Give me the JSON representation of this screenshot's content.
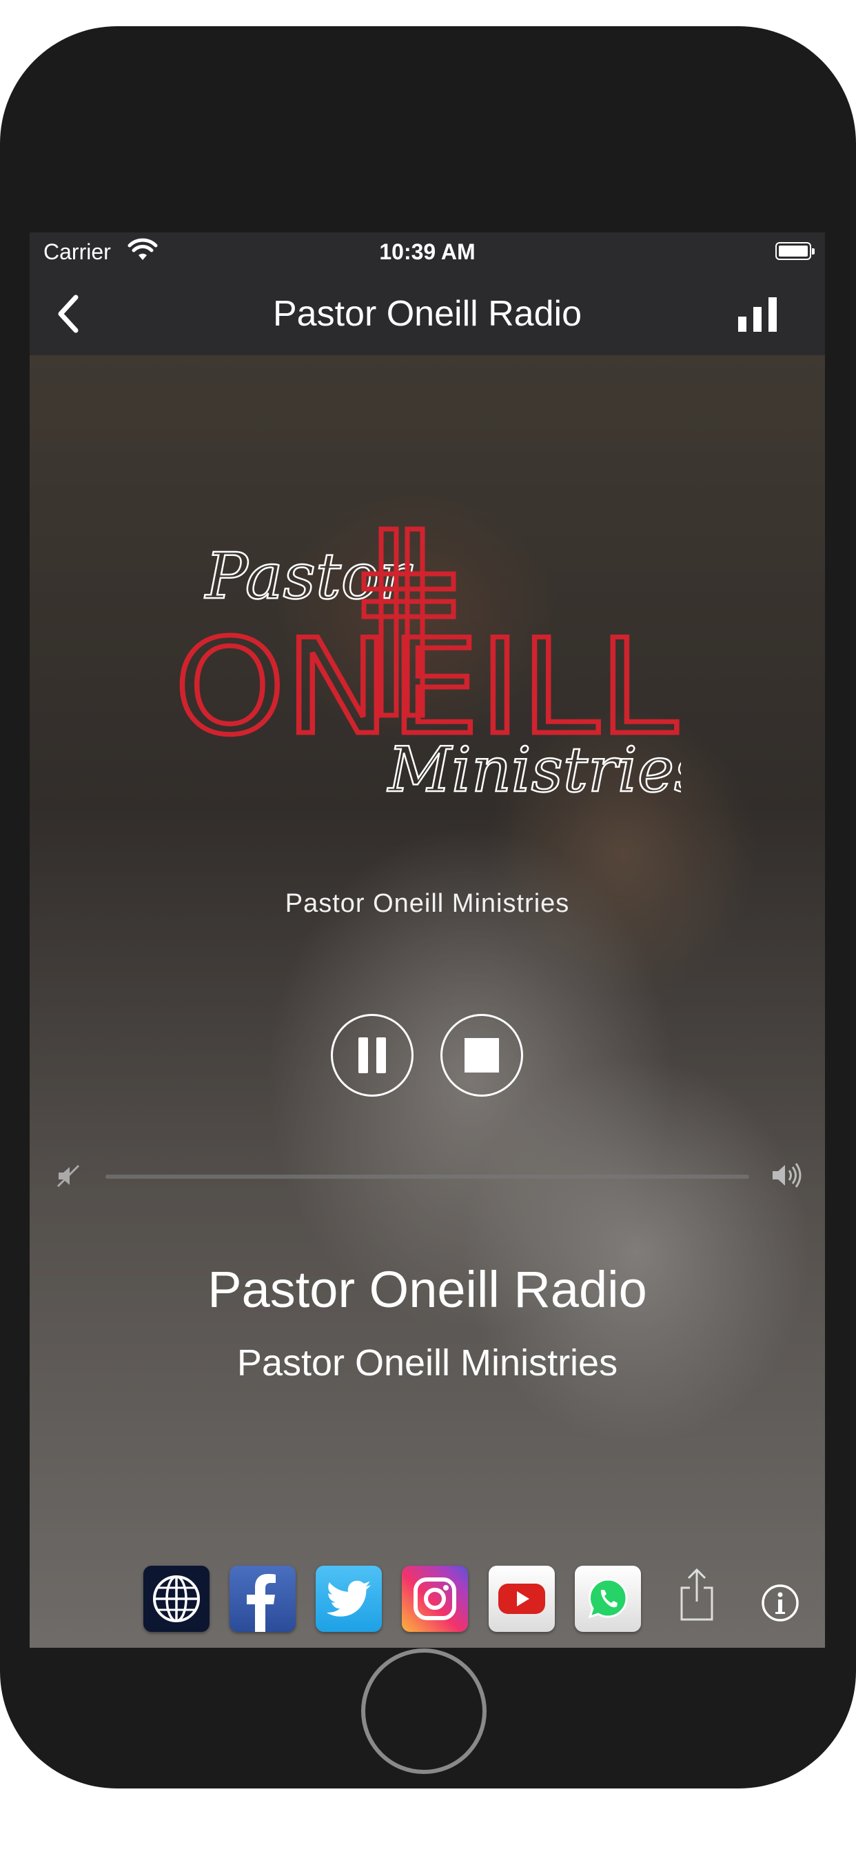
{
  "status_bar": {
    "carrier": "Carrier",
    "time": "10:39 AM"
  },
  "nav_bar": {
    "title": "Pastor Oneill Radio"
  },
  "logo": {
    "line1": "Pastor",
    "line2": "ONEILL",
    "line3": "Ministries",
    "accent": "#d0232e"
  },
  "player": {
    "station_caption": "Pastor Oneill Ministries",
    "state": "playing",
    "volume": 0.0
  },
  "now_playing": {
    "title": "Pastor Oneill Radio",
    "subtitle": "Pastor Oneill Ministries"
  },
  "social_links": [
    {
      "name": "website",
      "icon": "globe-icon",
      "color": "#0d1630"
    },
    {
      "name": "facebook",
      "icon": "facebook-icon",
      "color": "#3b5998"
    },
    {
      "name": "twitter",
      "icon": "twitter-icon",
      "color": "#1da1f2"
    },
    {
      "name": "instagram",
      "icon": "instagram-icon",
      "color": "#e1306c"
    },
    {
      "name": "youtube",
      "icon": "youtube-icon",
      "color": "#e52d27"
    },
    {
      "name": "whatsapp",
      "icon": "whatsapp-icon",
      "color": "#25d366"
    }
  ]
}
